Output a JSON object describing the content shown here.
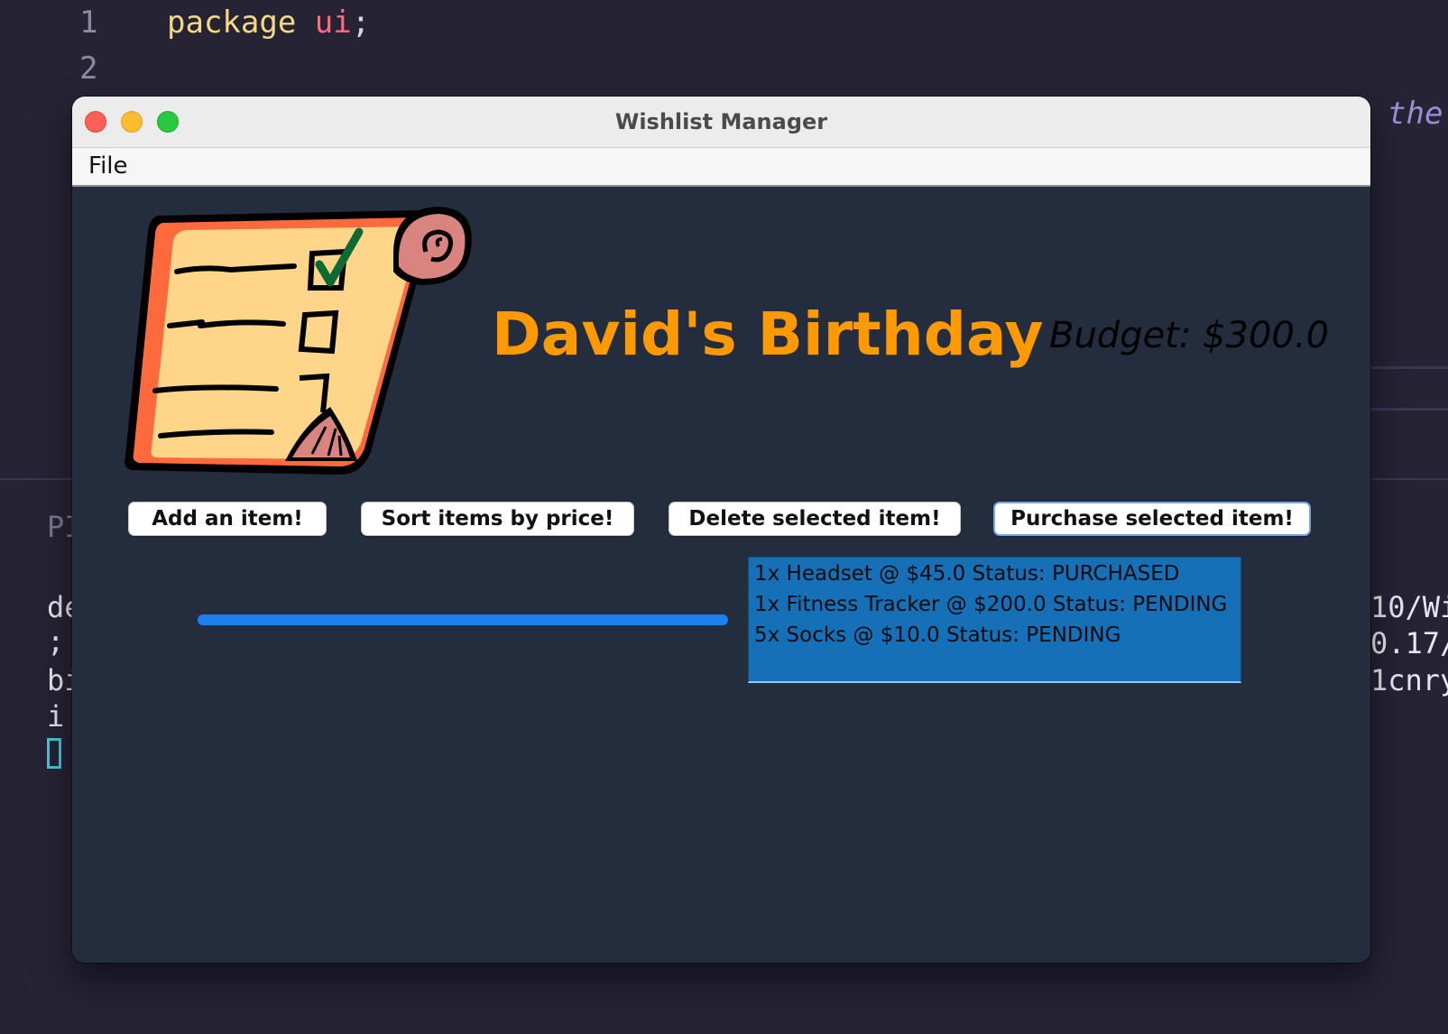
{
  "editor": {
    "line_numbers": [
      "1",
      "2"
    ],
    "code_line_1": {
      "keyword": "package",
      "name": "ui",
      "end": ";"
    },
    "italic_fragment": "the",
    "terminal_left": {
      "header": "PI",
      "lines": [
        "de",
        ";",
        "bi",
        "i"
      ]
    },
    "terminal_right": [
      "10/Wi",
      "0.17/",
      "1cnry"
    ]
  },
  "window": {
    "title": "Wishlist Manager",
    "menu": {
      "file_label": "File"
    },
    "heading": "David's Birthday",
    "budget_text": "Budget: $300.0",
    "buttons": {
      "add": "Add an item!",
      "sort": "Sort items by price!",
      "delete": "Delete selected item!",
      "purchase": "Purchase selected item!"
    },
    "items": [
      "1x Headset @ $45.0 Status: PURCHASED",
      "1x Fitness Tracker @ $200.0 Status: PENDING",
      "5x Socks @ $10.0 Status: PENDING"
    ],
    "progress_fraction": 1.0
  },
  "colors": {
    "heading": "#ff9900",
    "content_bg": "#232d3d",
    "list_bg": "#1670b8",
    "progress": "#1a82f0"
  },
  "icons": [
    "close-icon",
    "minimize-icon",
    "maximize-icon",
    "wishlist-scroll-logo"
  ]
}
